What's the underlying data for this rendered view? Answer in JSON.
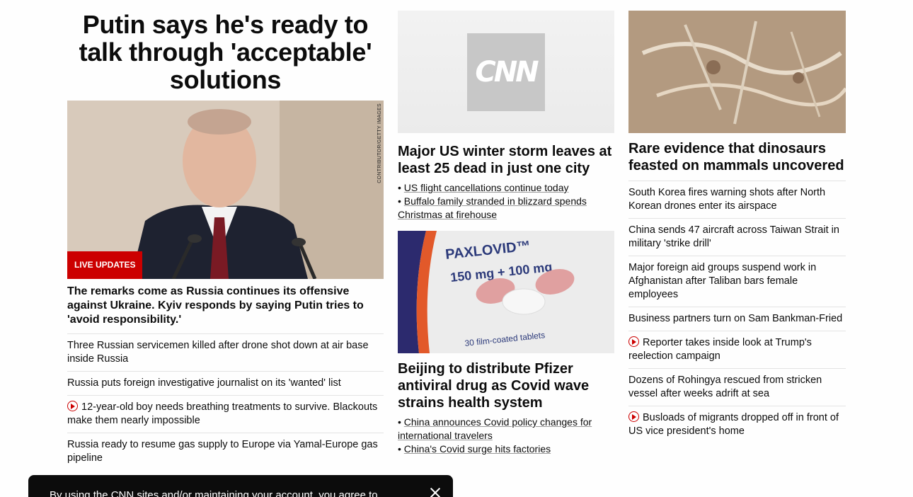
{
  "hero": {
    "title": "Putin says he's ready to talk through 'acceptable' solutions",
    "image_credit": "CONTRIBUTOR/GETTY IMAGES",
    "badge": "LIVE UPDATES",
    "summary": "The remarks come as Russia continues its offensive against Ukraine. Kyiv responds by saying Putin tries to 'avoid responsibility.'",
    "links": [
      {
        "text": "Three Russian servicemen killed after drone shot down at air base inside Russia",
        "video": false
      },
      {
        "text": "Russia puts foreign investigative journalist on its 'wanted' list",
        "video": false
      },
      {
        "text": "12-year-old boy needs breathing treatments to survive. Blackouts make them nearly impossible",
        "video": true
      },
      {
        "text": "Russia ready to resume gas supply to Europe via Yamal-Europe gas pipeline",
        "video": false
      }
    ]
  },
  "col2": {
    "storm": {
      "logo_text": "CNN",
      "title": "Major US winter storm leaves at least 25 dead in just one city",
      "bullets": [
        "US flight cancellations continue today",
        "Buffalo family stranded in blizzard spends Christmas at firehouse"
      ]
    },
    "covid": {
      "image_text": [
        "PAXLOVID™",
        "150 mg + 100 mg",
        "30 film-coated tablets"
      ],
      "title": "Beijing to distribute Pfizer antiviral drug as Covid wave strains health system",
      "bullets": [
        "China announces Covid policy changes for international travelers",
        "China's Covid surge hits factories"
      ]
    }
  },
  "col3": {
    "title": "Rare evidence that dinosaurs feasted on mammals uncovered",
    "links": [
      {
        "text": "South Korea fires warning shots after North Korean drones enter its airspace",
        "video": false
      },
      {
        "text": "China sends 47 aircraft across Taiwan Strait in military 'strike drill'",
        "video": false
      },
      {
        "text": "Major foreign aid groups suspend work in Afghanistan after Taliban bars female employees",
        "video": false
      },
      {
        "text": "Business partners turn on Sam Bankman-Fried",
        "video": false
      },
      {
        "text": "Reporter takes inside look at Trump's reelection campaign",
        "video": true
      },
      {
        "text": "Dozens of Rohingya rescued from stricken vessel after weeks adrift at sea",
        "video": false
      },
      {
        "text": "Busloads of migrants dropped off in front of US vice president's home",
        "video": true
      }
    ]
  },
  "cookie": {
    "text": "By using the CNN sites and/or maintaining your account, you agree to"
  },
  "colors": {
    "accent": "#cc0000",
    "text": "#0c0c0c",
    "divider": "#e3e3e3"
  }
}
